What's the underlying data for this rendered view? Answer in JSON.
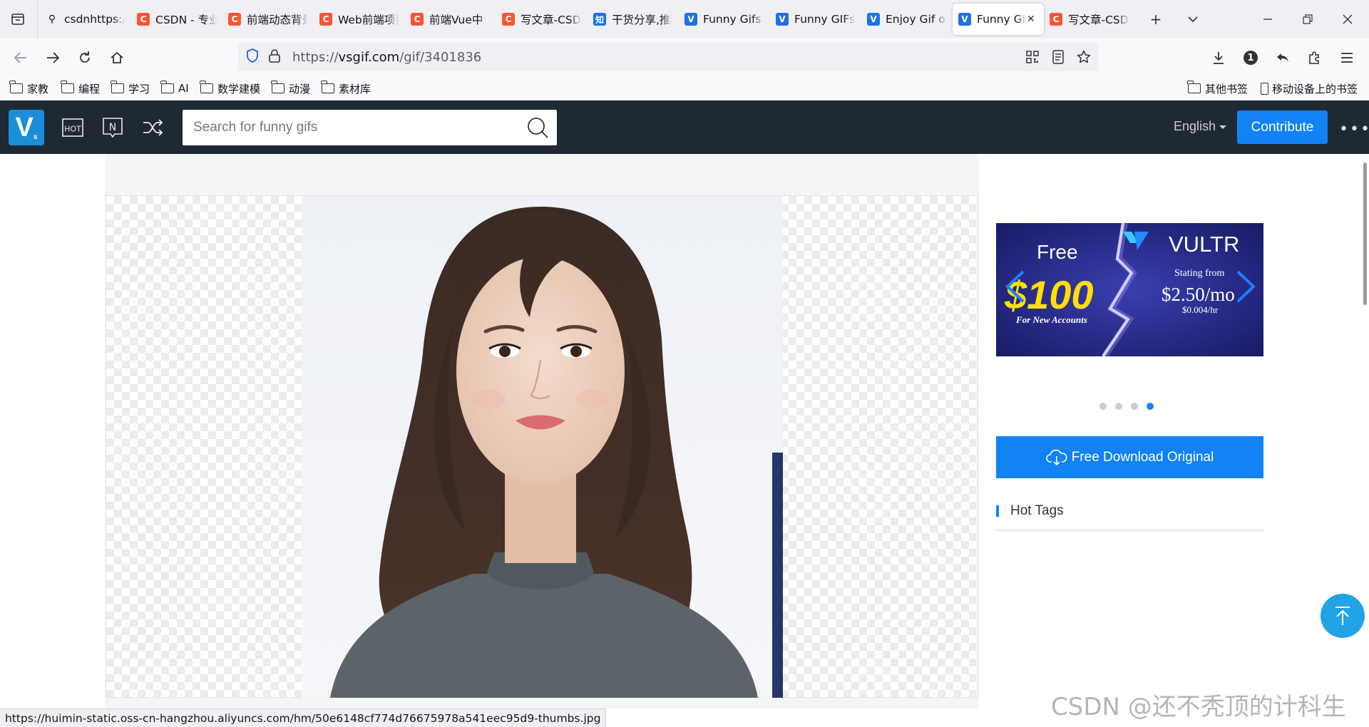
{
  "browser": {
    "tabs": [
      {
        "title": "csdnhttps://",
        "favicon": "search-icon",
        "active": false
      },
      {
        "title": "CSDN - 专业开发者社区",
        "favicon": "csdn-favicon",
        "active": false
      },
      {
        "title": "前端动态背景",
        "favicon": "csdn-favicon",
        "active": false
      },
      {
        "title": "Web前端项目",
        "favicon": "csdn-favicon",
        "active": false
      },
      {
        "title": "前端Vue中",
        "favicon": "csdn-favicon",
        "active": false
      },
      {
        "title": "写文章-CSDN",
        "favicon": "csdn-favicon",
        "active": false
      },
      {
        "title": "干货分享,推荐",
        "favicon": "zhihu-favicon",
        "active": false
      },
      {
        "title": "Funny Gifs",
        "favicon": "vsgif-favicon",
        "active": false
      },
      {
        "title": "Funny GIFs",
        "favicon": "vsgif-favicon",
        "active": false
      },
      {
        "title": "Enjoy Gif on",
        "favicon": "vsgif-favicon",
        "active": false
      },
      {
        "title": "Funny GIF",
        "favicon": "vsgif-favicon",
        "active": true
      },
      {
        "title": "写文章-CSDN",
        "favicon": "csdn-favicon",
        "active": false
      }
    ],
    "url": {
      "scheme": "https://",
      "domain": "vsgif.com",
      "path": "/gif/3401836"
    },
    "bookmarks": [
      "家教",
      "编程",
      "学习",
      "AI",
      "数学建模",
      "动漫",
      "素材库"
    ],
    "bookmarks_right": {
      "other": "其他书签",
      "mobile": "移动设备上的书签"
    },
    "status_url": "https://huimin-static.oss-cn-hangzhou.aliyuncs.com/hm/50e6148cf774d76675978a541eec95d9-thumbs.jpg",
    "badge_count": "1"
  },
  "site": {
    "logo_letter": "V",
    "logo_sub": "s",
    "hot_label": "HOT",
    "new_label": "N",
    "search_placeholder": "Search for funny gifs",
    "language": "English",
    "contribute_label": "Contribute"
  },
  "ad": {
    "free": "Free",
    "amount": "$100",
    "for_new": "For New Accounts",
    "brand": "VULTR",
    "starting": "Stating from",
    "price": "$2.50/mo",
    "price_hr": "$0.004/hr",
    "slide_count": 4,
    "active_slide": 4
  },
  "sidebar": {
    "download_label": "Free Download Original",
    "hot_tags_title": "Hot Tags"
  },
  "watermark": "CSDN @还不秃顶的计科生",
  "colors": {
    "header_bg": "#1f2933",
    "primary_blue": "#1282f5",
    "back_to_top": "#21a3e6"
  }
}
